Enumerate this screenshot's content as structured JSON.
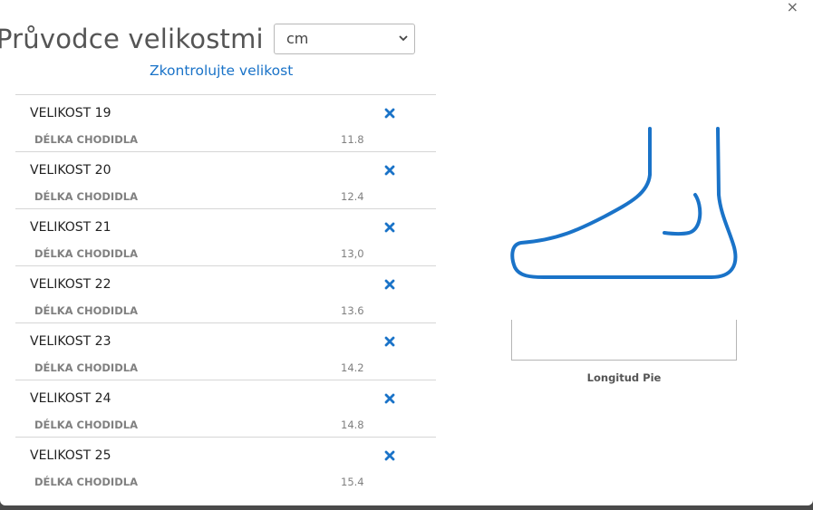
{
  "modal": {
    "close_glyph": "×",
    "title": "Průvodce velikostmi",
    "unit_select": {
      "selected": "cm"
    },
    "check_link": "Zkontrolujte velikost"
  },
  "sizes": [
    {
      "name": "VELIKOST 19",
      "measure_label": "DÉLKA CHODIDLA",
      "value": "11.8"
    },
    {
      "name": "VELIKOST 20",
      "measure_label": "DÉLKA CHODIDLA",
      "value": "12.4"
    },
    {
      "name": "VELIKOST 21",
      "measure_label": "DÉLKA CHODIDLA",
      "value": "13,0"
    },
    {
      "name": "VELIKOST 22",
      "measure_label": "DÉLKA CHODIDLA",
      "value": "13.6"
    },
    {
      "name": "VELIKOST 23",
      "measure_label": "DÉLKA CHODIDLA",
      "value": "14.2"
    },
    {
      "name": "VELIKOST 24",
      "measure_label": "DÉLKA CHODIDLA",
      "value": "14.8"
    },
    {
      "name": "VELIKOST 25",
      "measure_label": "DÉLKA CHODIDLA",
      "value": "15.4"
    }
  ],
  "illustration": {
    "foot_length_label": "Longitud Pie",
    "stroke_color": "#1a73c8"
  },
  "colors": {
    "accent": "#1a73c8",
    "remove_icon": "#1a73c8"
  }
}
